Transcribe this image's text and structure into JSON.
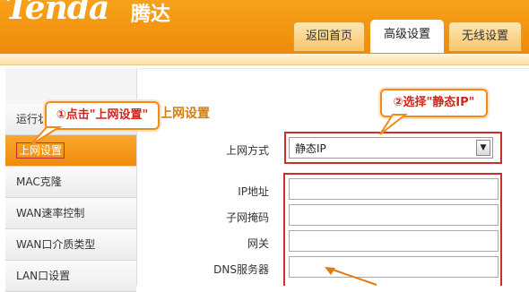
{
  "header": {
    "logo": "Tenda",
    "logo_cn": "腾达",
    "tabs": [
      {
        "label": "返回首页"
      },
      {
        "label": "高级设置",
        "active": true
      },
      {
        "label": "无线设置"
      }
    ]
  },
  "sidebar": {
    "items": [
      {
        "label": "运行状态"
      },
      {
        "label": "上网设置",
        "active": true
      },
      {
        "label": "MAC克隆"
      },
      {
        "label": "WAN速率控制"
      },
      {
        "label": "WAN口介质类型"
      },
      {
        "label": "LAN口设置"
      }
    ]
  },
  "main": {
    "section_title": "上网设置",
    "connection_type": {
      "label": "上网方式",
      "value": "静态IP"
    },
    "fields": [
      {
        "label": "IP地址",
        "value": ""
      },
      {
        "label": "子网掩码",
        "value": ""
      },
      {
        "label": "网关",
        "value": ""
      },
      {
        "label": "DNS服务器",
        "value": ""
      }
    ]
  },
  "annotations": {
    "step1": "①点击\"上网设置\"",
    "step2": "②选择\"静态IP\""
  },
  "colors": {
    "brand_orange": "#f08a0a",
    "highlight_red": "#c9302c"
  }
}
